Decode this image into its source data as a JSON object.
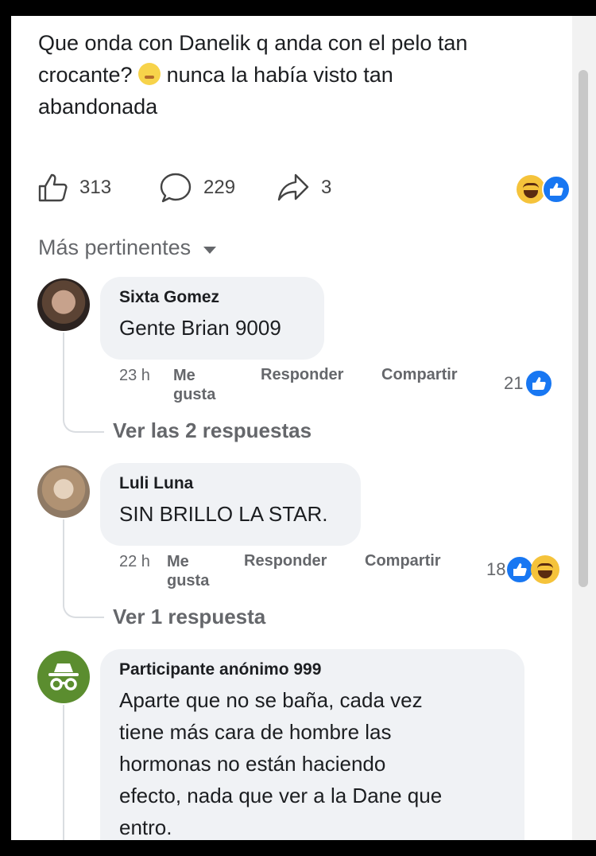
{
  "post": {
    "text_line1": "Que onda con Danelik q anda con el pelo tan",
    "text_line2_a": "crocante?",
    "text_line2_b": " nunca la había visto tan",
    "text_line3": "abandonada",
    "emoji_name": "flushed-face-emoji"
  },
  "actions": {
    "likes": "313",
    "comments": "229",
    "shares": "3"
  },
  "sort": {
    "label": "Más pertinentes"
  },
  "comments": [
    {
      "name": "Sixta Gomez",
      "text": "Gente Brian 9009",
      "time": "23 h",
      "like_label": "Me gusta",
      "reply_label": "Responder",
      "share_label": "Compartir",
      "reactions": "21",
      "view_replies": "Ver las 2 respuestas"
    },
    {
      "name": "Luli Luna",
      "text": "SIN BRILLO LA STAR.",
      "time": "22 h",
      "like_label": "Me gusta",
      "reply_label": "Responder",
      "share_label": "Compartir",
      "reactions": "18",
      "view_replies": "Ver 1 respuesta"
    },
    {
      "name": "Participante anónimo 999",
      "text_lines": [
        "Aparte que no se baña, cada vez",
        "tiene más cara de hombre las",
        "hormonas no están haciendo",
        "efecto, nada que ver a la Dane que",
        "entro."
      ]
    }
  ],
  "colors": {
    "accent": "#1877f2",
    "text": "#1c1e21",
    "secondary": "#65676b",
    "bubble": "#f0f2f5"
  }
}
